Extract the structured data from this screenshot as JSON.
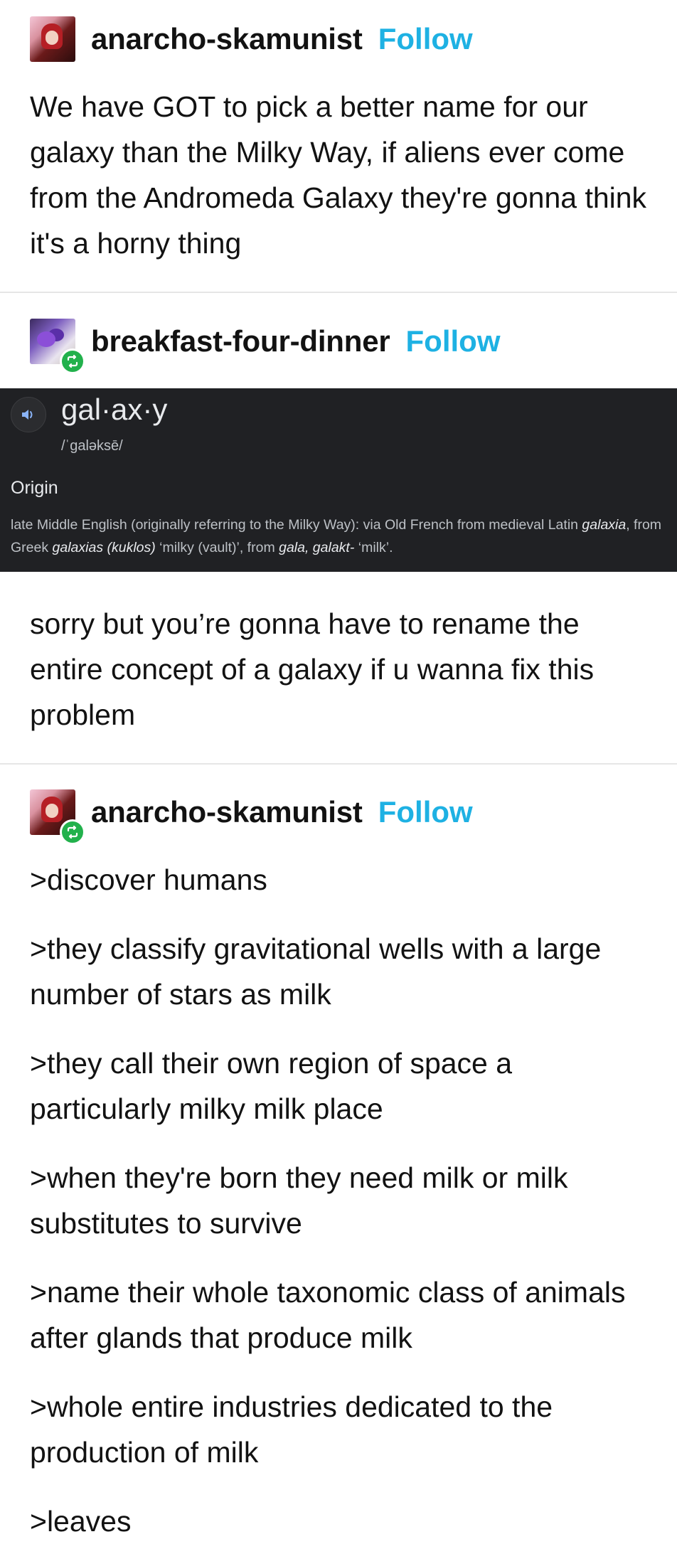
{
  "posts": [
    {
      "username": "anarcho-skamunist",
      "follow_label": "Follow",
      "avatar_icon": "avatar-red-hair-icon",
      "text": "We have GOT to pick a better name for our galaxy than the Milky Way, if aliens ever come from the Andromeda Galaxy they're gonna think it's a horny thing"
    },
    {
      "username": "breakfast-four-dinner",
      "follow_label": "Follow",
      "avatar_icon": "avatar-purple-flower-icon",
      "reblog_icon": "reblog-icon",
      "dictionary": {
        "speaker_icon": "speaker-icon",
        "word": "gal·ax·y",
        "pronunciation": "/ˈɡaləksē/",
        "origin_label": "Origin",
        "origin_segments": [
          {
            "t": "late Middle English (originally referring to the Milky Way): via Old French from medieval Latin ",
            "i": false
          },
          {
            "t": "galaxia",
            "i": true
          },
          {
            "t": ", from Greek ",
            "i": false
          },
          {
            "t": "galaxias (kuklos)",
            "i": true
          },
          {
            "t": " ‘milky (vault)’, from ",
            "i": false
          },
          {
            "t": "gala, galakt-",
            "i": true
          },
          {
            "t": " ‘milk’.",
            "i": false
          }
        ]
      },
      "text": "sorry but you’re gonna have to rename the entire concept of a galaxy if u wanna fix this problem"
    },
    {
      "username": "anarcho-skamunist",
      "follow_label": "Follow",
      "avatar_icon": "avatar-red-hair-icon",
      "reblog_icon": "reblog-icon",
      "paragraphs": [
        ">discover humans",
        ">they classify gravitational wells with a large number of stars as milk",
        ">they call their own region of space a particularly milky milk place",
        ">when they're born they need milk or milk substitutes to survive",
        ">name their whole taxonomic class of animals after glands that produce milk",
        ">whole entire industries dedicated to the production of milk",
        ">leaves"
      ]
    }
  ],
  "colors": {
    "follow": "#1eb1e3",
    "reblog_badge": "#22b14c",
    "dictionary_bg": "#202124"
  }
}
